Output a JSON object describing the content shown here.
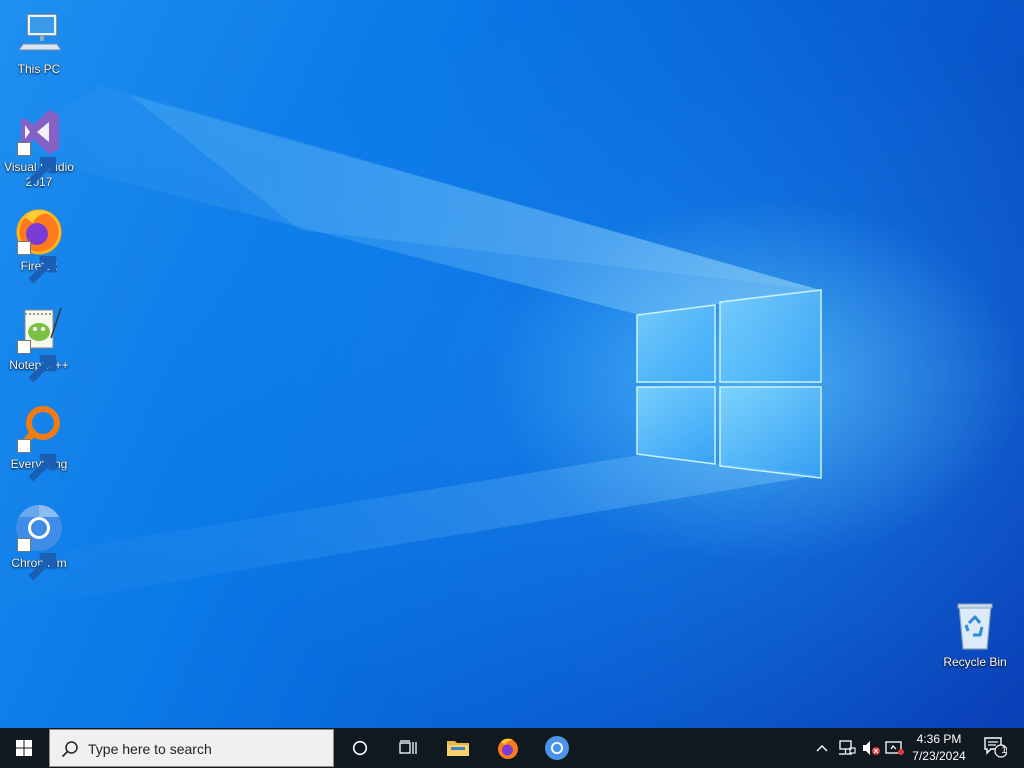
{
  "desktop": {
    "icons": [
      {
        "label": "This PC",
        "icon": "computer-icon"
      },
      {
        "label": "Visual Studio 2017",
        "icon": "visual-studio-icon"
      },
      {
        "label": "Firefox",
        "icon": "firefox-icon"
      },
      {
        "label": "Notepad++",
        "icon": "notepad-plus-plus-icon"
      },
      {
        "label": "Everything",
        "icon": "everything-search-icon"
      },
      {
        "label": "Chromium",
        "icon": "chromium-icon"
      },
      {
        "label": "Recycle Bin",
        "icon": "recycle-bin-icon"
      }
    ]
  },
  "taskbar": {
    "search": {
      "placeholder": "Type here to search",
      "icon": "search-icon"
    },
    "buttons": [
      {
        "name": "start",
        "icon": "windows-logo-icon"
      },
      {
        "name": "cortana",
        "icon": "circle-icon"
      },
      {
        "name": "task-view",
        "icon": "task-view-icon"
      },
      {
        "name": "file-explorer",
        "icon": "folder-icon"
      },
      {
        "name": "firefox",
        "icon": "firefox-icon"
      },
      {
        "name": "chromium",
        "icon": "chromium-icon"
      }
    ],
    "tray": {
      "icons": [
        "chevron-up-icon",
        "network-icon",
        "volume-muted-icon",
        "display-icon"
      ],
      "time": "4:36 PM",
      "date": "7/23/2024",
      "notifications": {
        "icon": "notification-icon",
        "count": "1"
      }
    }
  },
  "colors": {
    "taskbar": "#101820",
    "desktop_accent": "#0a78e6",
    "search_box": "#f0f0f0"
  }
}
